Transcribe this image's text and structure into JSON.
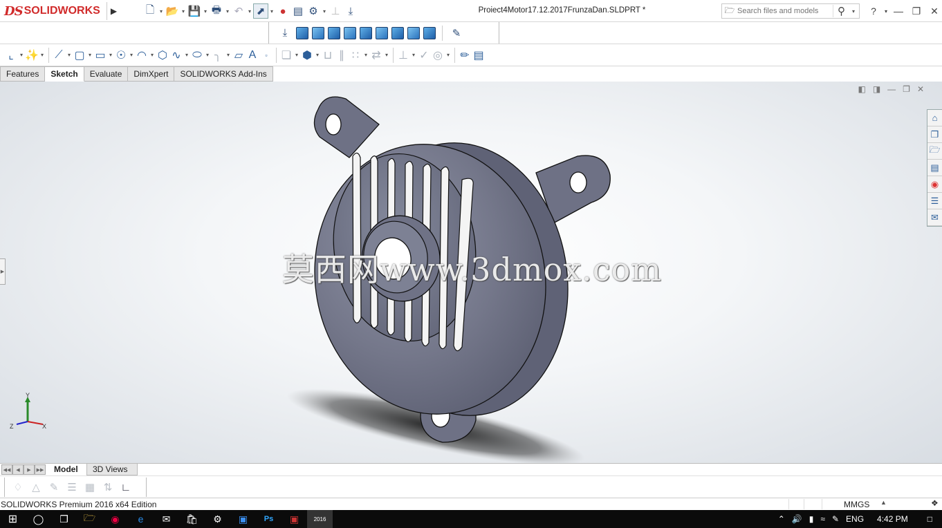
{
  "titlebar": {
    "logo_ds": "DS",
    "logo_brand": "SOLIDWORKS",
    "document_title": "Proiect4Motor17.12.2017FrunzaDan.SLDPRT *",
    "search_placeholder": "Search files and models",
    "help_label": "?"
  },
  "tabs": [
    {
      "label": "Features"
    },
    {
      "label": "Sketch"
    },
    {
      "label": "Evaluate"
    },
    {
      "label": "DimXpert"
    },
    {
      "label": "SOLIDWORKS Add-Ins"
    }
  ],
  "active_tab": "Sketch",
  "viewport": {
    "watermark": "莫西网www.3dmox.com",
    "axis_x": "X",
    "axis_y": "Y",
    "axis_z": "Z"
  },
  "bottom_tabs": [
    {
      "label": "Model"
    },
    {
      "label": "3D Views"
    }
  ],
  "status": {
    "edition": "SOLIDWORKS Premium 2016 x64 Edition",
    "units": "MMGS"
  },
  "taskbar": {
    "language": "ENG",
    "clock": "4:42 PM",
    "app_badge": "2016"
  },
  "colors": {
    "brand": "#d12b2b",
    "part_body": "#7b7e91",
    "toolbar_icon": "#2d5f9a",
    "taskbar_bg": "#0b0b0b"
  }
}
